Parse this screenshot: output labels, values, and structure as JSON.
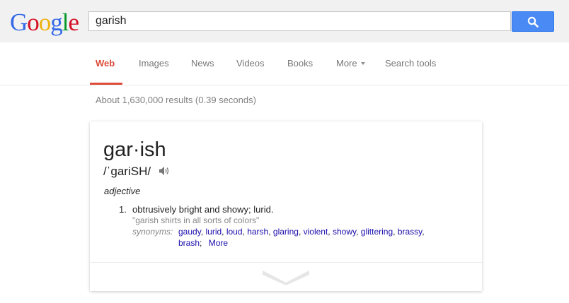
{
  "logo": {
    "letters": [
      "G",
      "o",
      "o",
      "g",
      "l",
      "e"
    ],
    "colors": [
      "#3369e8",
      "#d50f25",
      "#eeb211",
      "#3369e8",
      "#009925",
      "#d50f25"
    ]
  },
  "search": {
    "value": "garish",
    "button_icon": "search-icon"
  },
  "nav": {
    "tabs": [
      "Web",
      "Images",
      "News",
      "Videos",
      "Books",
      "More",
      "Search tools"
    ],
    "active": "Web"
  },
  "stats": "About 1,630,000 results (0.39 seconds)",
  "definition": {
    "word": "gar·ish",
    "phonetic": "/ˈgariSH/",
    "part_of_speech": "adjective",
    "number": "1.",
    "meaning": "obtrusively bright and showy; lurid.",
    "example": "\"garish shirts in all sorts of colors\"",
    "synonyms_label": "synonyms:",
    "synonyms": [
      "gaudy",
      "lurid",
      "loud",
      "harsh",
      "glaring",
      "violent",
      "showy",
      "glittering",
      "brassy",
      "brash"
    ],
    "more_label": "More"
  },
  "colors": {
    "accent": "#dd4b39",
    "link": "#1a0dab",
    "button": "#4a8af4"
  }
}
